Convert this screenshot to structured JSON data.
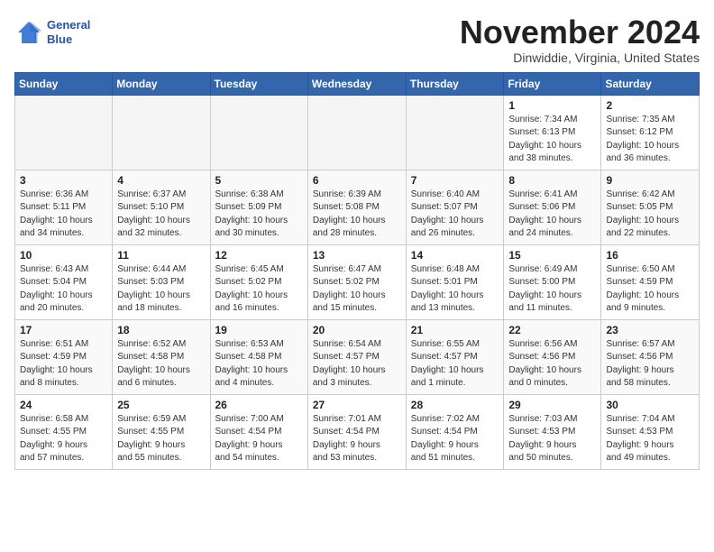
{
  "logo": {
    "line1": "General",
    "line2": "Blue"
  },
  "title": "November 2024",
  "location": "Dinwiddie, Virginia, United States",
  "days_of_week": [
    "Sunday",
    "Monday",
    "Tuesday",
    "Wednesday",
    "Thursday",
    "Friday",
    "Saturday"
  ],
  "weeks": [
    [
      {
        "day": "",
        "info": ""
      },
      {
        "day": "",
        "info": ""
      },
      {
        "day": "",
        "info": ""
      },
      {
        "day": "",
        "info": ""
      },
      {
        "day": "",
        "info": ""
      },
      {
        "day": "1",
        "info": "Sunrise: 7:34 AM\nSunset: 6:13 PM\nDaylight: 10 hours\nand 38 minutes."
      },
      {
        "day": "2",
        "info": "Sunrise: 7:35 AM\nSunset: 6:12 PM\nDaylight: 10 hours\nand 36 minutes."
      }
    ],
    [
      {
        "day": "3",
        "info": "Sunrise: 6:36 AM\nSunset: 5:11 PM\nDaylight: 10 hours\nand 34 minutes."
      },
      {
        "day": "4",
        "info": "Sunrise: 6:37 AM\nSunset: 5:10 PM\nDaylight: 10 hours\nand 32 minutes."
      },
      {
        "day": "5",
        "info": "Sunrise: 6:38 AM\nSunset: 5:09 PM\nDaylight: 10 hours\nand 30 minutes."
      },
      {
        "day": "6",
        "info": "Sunrise: 6:39 AM\nSunset: 5:08 PM\nDaylight: 10 hours\nand 28 minutes."
      },
      {
        "day": "7",
        "info": "Sunrise: 6:40 AM\nSunset: 5:07 PM\nDaylight: 10 hours\nand 26 minutes."
      },
      {
        "day": "8",
        "info": "Sunrise: 6:41 AM\nSunset: 5:06 PM\nDaylight: 10 hours\nand 24 minutes."
      },
      {
        "day": "9",
        "info": "Sunrise: 6:42 AM\nSunset: 5:05 PM\nDaylight: 10 hours\nand 22 minutes."
      }
    ],
    [
      {
        "day": "10",
        "info": "Sunrise: 6:43 AM\nSunset: 5:04 PM\nDaylight: 10 hours\nand 20 minutes."
      },
      {
        "day": "11",
        "info": "Sunrise: 6:44 AM\nSunset: 5:03 PM\nDaylight: 10 hours\nand 18 minutes."
      },
      {
        "day": "12",
        "info": "Sunrise: 6:45 AM\nSunset: 5:02 PM\nDaylight: 10 hours\nand 16 minutes."
      },
      {
        "day": "13",
        "info": "Sunrise: 6:47 AM\nSunset: 5:02 PM\nDaylight: 10 hours\nand 15 minutes."
      },
      {
        "day": "14",
        "info": "Sunrise: 6:48 AM\nSunset: 5:01 PM\nDaylight: 10 hours\nand 13 minutes."
      },
      {
        "day": "15",
        "info": "Sunrise: 6:49 AM\nSunset: 5:00 PM\nDaylight: 10 hours\nand 11 minutes."
      },
      {
        "day": "16",
        "info": "Sunrise: 6:50 AM\nSunset: 4:59 PM\nDaylight: 10 hours\nand 9 minutes."
      }
    ],
    [
      {
        "day": "17",
        "info": "Sunrise: 6:51 AM\nSunset: 4:59 PM\nDaylight: 10 hours\nand 8 minutes."
      },
      {
        "day": "18",
        "info": "Sunrise: 6:52 AM\nSunset: 4:58 PM\nDaylight: 10 hours\nand 6 minutes."
      },
      {
        "day": "19",
        "info": "Sunrise: 6:53 AM\nSunset: 4:58 PM\nDaylight: 10 hours\nand 4 minutes."
      },
      {
        "day": "20",
        "info": "Sunrise: 6:54 AM\nSunset: 4:57 PM\nDaylight: 10 hours\nand 3 minutes."
      },
      {
        "day": "21",
        "info": "Sunrise: 6:55 AM\nSunset: 4:57 PM\nDaylight: 10 hours\nand 1 minute."
      },
      {
        "day": "22",
        "info": "Sunrise: 6:56 AM\nSunset: 4:56 PM\nDaylight: 10 hours\nand 0 minutes."
      },
      {
        "day": "23",
        "info": "Sunrise: 6:57 AM\nSunset: 4:56 PM\nDaylight: 9 hours\nand 58 minutes."
      }
    ],
    [
      {
        "day": "24",
        "info": "Sunrise: 6:58 AM\nSunset: 4:55 PM\nDaylight: 9 hours\nand 57 minutes."
      },
      {
        "day": "25",
        "info": "Sunrise: 6:59 AM\nSunset: 4:55 PM\nDaylight: 9 hours\nand 55 minutes."
      },
      {
        "day": "26",
        "info": "Sunrise: 7:00 AM\nSunset: 4:54 PM\nDaylight: 9 hours\nand 54 minutes."
      },
      {
        "day": "27",
        "info": "Sunrise: 7:01 AM\nSunset: 4:54 PM\nDaylight: 9 hours\nand 53 minutes."
      },
      {
        "day": "28",
        "info": "Sunrise: 7:02 AM\nSunset: 4:54 PM\nDaylight: 9 hours\nand 51 minutes."
      },
      {
        "day": "29",
        "info": "Sunrise: 7:03 AM\nSunset: 4:53 PM\nDaylight: 9 hours\nand 50 minutes."
      },
      {
        "day": "30",
        "info": "Sunrise: 7:04 AM\nSunset: 4:53 PM\nDaylight: 9 hours\nand 49 minutes."
      }
    ]
  ]
}
